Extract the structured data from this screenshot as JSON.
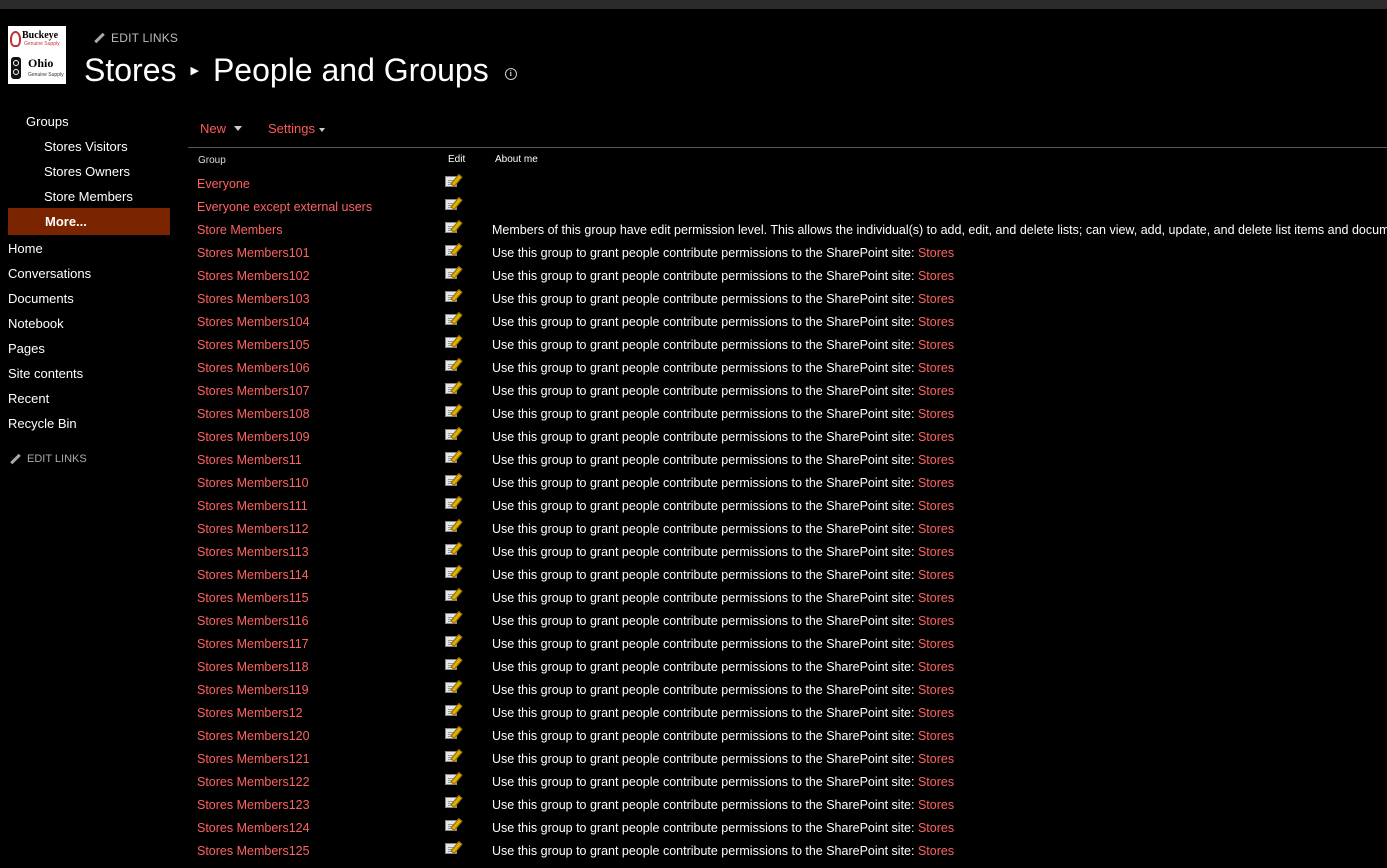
{
  "header": {
    "edit_links": "EDIT LINKS",
    "site": "Stores",
    "page_title": "People and Groups",
    "logo_top": "Buckeye",
    "logo_top_sub": "Genuine Supply",
    "logo_bottom": "Ohio",
    "logo_bottom_sub": "Genuine Supply"
  },
  "nav": {
    "groups_heading": "Groups",
    "group_links": [
      "Stores Visitors",
      "Stores Owners",
      "Store Members"
    ],
    "more": "More...",
    "links": [
      "Home",
      "Conversations",
      "Documents",
      "Notebook",
      "Pages",
      "Site contents",
      "Recent",
      "Recycle Bin"
    ],
    "edit_links": "EDIT LINKS"
  },
  "toolbar": {
    "new": "New",
    "settings": "Settings"
  },
  "table": {
    "headers": {
      "group": "Group",
      "edit": "Edit",
      "about": "About me"
    },
    "link_text": "Stores",
    "rows": [
      {
        "name": "Everyone",
        "about": "",
        "link": ""
      },
      {
        "name": "Everyone except external users",
        "about": "",
        "link": ""
      },
      {
        "name": "Store Members",
        "about": "Members of this group have edit permission level. This allows the individual(s) to add, edit, and delete lists; can view, add, update, and delete list items and documents",
        "link": ""
      },
      {
        "name": "Stores Members101",
        "about": "Use this group to grant people contribute permissions to the SharePoint site: ",
        "link": "Stores"
      },
      {
        "name": "Stores Members102",
        "about": "Use this group to grant people contribute permissions to the SharePoint site: ",
        "link": "Stores"
      },
      {
        "name": "Stores Members103",
        "about": "Use this group to grant people contribute permissions to the SharePoint site: ",
        "link": "Stores"
      },
      {
        "name": "Stores Members104",
        "about": "Use this group to grant people contribute permissions to the SharePoint site: ",
        "link": "Stores"
      },
      {
        "name": "Stores Members105",
        "about": "Use this group to grant people contribute permissions to the SharePoint site: ",
        "link": "Stores"
      },
      {
        "name": "Stores Members106",
        "about": "Use this group to grant people contribute permissions to the SharePoint site: ",
        "link": "Stores"
      },
      {
        "name": "Stores Members107",
        "about": "Use this group to grant people contribute permissions to the SharePoint site: ",
        "link": "Stores"
      },
      {
        "name": "Stores Members108",
        "about": "Use this group to grant people contribute permissions to the SharePoint site: ",
        "link": "Stores"
      },
      {
        "name": "Stores Members109",
        "about": "Use this group to grant people contribute permissions to the SharePoint site: ",
        "link": "Stores"
      },
      {
        "name": "Stores Members11",
        "about": "Use this group to grant people contribute permissions to the SharePoint site: ",
        "link": "Stores"
      },
      {
        "name": "Stores Members110",
        "about": "Use this group to grant people contribute permissions to the SharePoint site: ",
        "link": "Stores"
      },
      {
        "name": "Stores Members111",
        "about": "Use this group to grant people contribute permissions to the SharePoint site: ",
        "link": "Stores"
      },
      {
        "name": "Stores Members112",
        "about": "Use this group to grant people contribute permissions to the SharePoint site: ",
        "link": "Stores"
      },
      {
        "name": "Stores Members113",
        "about": "Use this group to grant people contribute permissions to the SharePoint site: ",
        "link": "Stores"
      },
      {
        "name": "Stores Members114",
        "about": "Use this group to grant people contribute permissions to the SharePoint site: ",
        "link": "Stores"
      },
      {
        "name": "Stores Members115",
        "about": "Use this group to grant people contribute permissions to the SharePoint site: ",
        "link": "Stores"
      },
      {
        "name": "Stores Members116",
        "about": "Use this group to grant people contribute permissions to the SharePoint site: ",
        "link": "Stores"
      },
      {
        "name": "Stores Members117",
        "about": "Use this group to grant people contribute permissions to the SharePoint site: ",
        "link": "Stores"
      },
      {
        "name": "Stores Members118",
        "about": "Use this group to grant people contribute permissions to the SharePoint site: ",
        "link": "Stores"
      },
      {
        "name": "Stores Members119",
        "about": "Use this group to grant people contribute permissions to the SharePoint site: ",
        "link": "Stores"
      },
      {
        "name": "Stores Members12",
        "about": "Use this group to grant people contribute permissions to the SharePoint site: ",
        "link": "Stores"
      },
      {
        "name": "Stores Members120",
        "about": "Use this group to grant people contribute permissions to the SharePoint site: ",
        "link": "Stores"
      },
      {
        "name": "Stores Members121",
        "about": "Use this group to grant people contribute permissions to the SharePoint site: ",
        "link": "Stores"
      },
      {
        "name": "Stores Members122",
        "about": "Use this group to grant people contribute permissions to the SharePoint site: ",
        "link": "Stores"
      },
      {
        "name": "Stores Members123",
        "about": "Use this group to grant people contribute permissions to the SharePoint site: ",
        "link": "Stores"
      },
      {
        "name": "Stores Members124",
        "about": "Use this group to grant people contribute permissions to the SharePoint site: ",
        "link": "Stores"
      },
      {
        "name": "Stores Members125",
        "about": "Use this group to grant people contribute permissions to the SharePoint site: ",
        "link": "Stores"
      }
    ]
  },
  "colors": {
    "accent": "#ff6262",
    "more_bg": "#7a2500",
    "background": "#000000"
  },
  "icons": {
    "edit": "edit-icon",
    "info": "info-icon",
    "pencil": "pencil-icon",
    "caret": "chevron-down-icon"
  }
}
